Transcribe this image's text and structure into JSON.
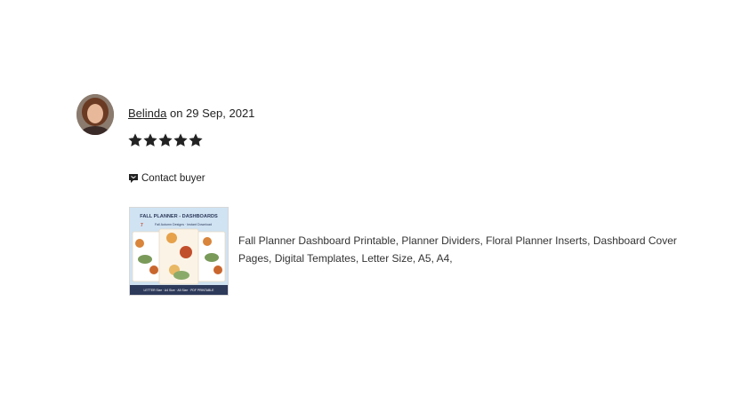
{
  "review": {
    "reviewer_name": "Belinda",
    "date_text": " on 29 Sep, 2021",
    "rating": 5,
    "rating_max": 5,
    "contact_label": "Contact buyer",
    "listing": {
      "title": "Fall Planner Dashboard Printable, Planner Dividers, Floral Planner Inserts, Dashboard Cover Pages, Digital Templates, Letter Size, A5, A4,",
      "thumb_heading": "FALL PLANNER - DASHBOARDS",
      "thumb_subheading": "Fall Autumn Designs · Instant Download",
      "thumb_count": "7",
      "thumb_footer": "LETTER Size · A4 Size · A5 Size · PDF PRINTABLE"
    }
  },
  "colors": {
    "text": "#222222",
    "star": "#222222",
    "thumb_footer_bg": "#2e3a5a"
  },
  "icons": {
    "star": "star-icon",
    "contact": "speech-bubble-icon"
  }
}
